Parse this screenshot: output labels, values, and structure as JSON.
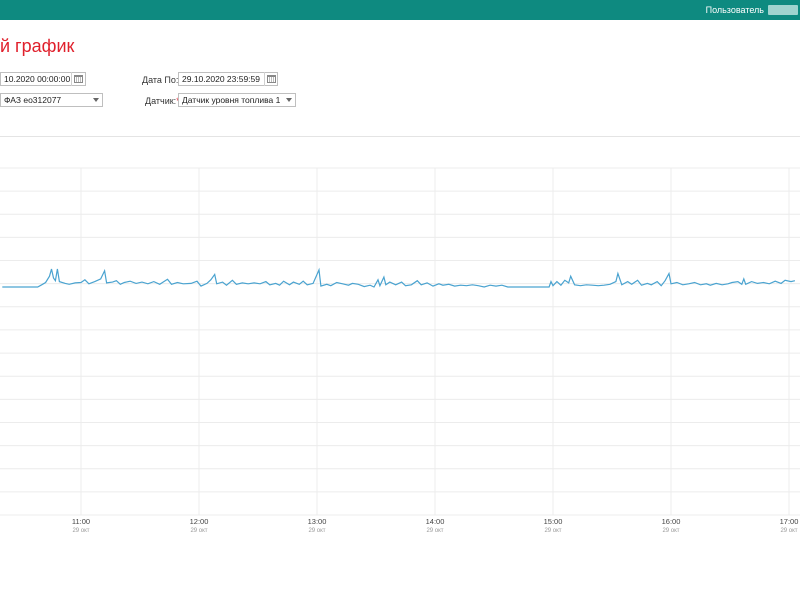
{
  "header": {
    "user_label": "Пользователь"
  },
  "page": {
    "title": "й график"
  },
  "filters": {
    "date_from_value": "10.2020 00:00:00",
    "date_to_label": "Дата По:",
    "required_mark": "*",
    "date_to_value": "29.10.2020 23:59:59",
    "vehicle_value": "ФАЗ ео312077",
    "sensor_label": "Датчик:",
    "sensor_value": "Датчик уровня топлива 1"
  },
  "colors": {
    "header_bg": "#0e8a80",
    "title": "#e0202c",
    "series_line": "#4aa3d0"
  },
  "chart_data": {
    "type": "line",
    "title": "",
    "xlabel": "",
    "ylabel": "",
    "grid": true,
    "x_ticks": [
      {
        "time": "11:00",
        "date": "29 окт"
      },
      {
        "time": "12:00",
        "date": "29 окт"
      },
      {
        "time": "13:00",
        "date": "29 окт"
      },
      {
        "time": "14:00",
        "date": "29 окт"
      },
      {
        "time": "15:00",
        "date": "29 окт"
      },
      {
        "time": "16:00",
        "date": "29 окт"
      },
      {
        "time": "17:00",
        "date": "29 окт"
      }
    ],
    "xlim": [
      "10:20",
      "17:03"
    ],
    "series": [
      {
        "points": [
          [
            "10:20",
            0.0
          ],
          [
            "10:38",
            0.0
          ],
          [
            "10:40",
            0.5
          ],
          [
            "10:42",
            1.0
          ],
          [
            "10:44",
            2.4
          ],
          [
            "10:45",
            4.0
          ],
          [
            "10:46",
            2.0
          ],
          [
            "10:47",
            1.4
          ],
          [
            "10:48",
            4.0
          ],
          [
            "10:49",
            1.2
          ],
          [
            "10:52",
            0.8
          ],
          [
            "10:54",
            0.6
          ],
          [
            "10:57",
            0.9
          ],
          [
            "11:00",
            1.0
          ],
          [
            "11:02",
            1.6
          ],
          [
            "11:04",
            0.7
          ],
          [
            "11:07",
            1.2
          ],
          [
            "11:10",
            1.8
          ],
          [
            "11:12",
            3.6
          ],
          [
            "11:13",
            0.9
          ],
          [
            "11:16",
            1.1
          ],
          [
            "11:18",
            1.4
          ],
          [
            "11:20",
            0.6
          ],
          [
            "11:22",
            1.0
          ],
          [
            "11:25",
            1.3
          ],
          [
            "11:28",
            0.8
          ],
          [
            "11:31",
            1.1
          ],
          [
            "11:34",
            0.7
          ],
          [
            "11:37",
            1.2
          ],
          [
            "11:40",
            0.6
          ],
          [
            "11:44",
            1.7
          ],
          [
            "11:46",
            0.6
          ],
          [
            "11:49",
            1.0
          ],
          [
            "11:52",
            0.7
          ],
          [
            "11:56",
            0.8
          ],
          [
            "11:59",
            1.3
          ],
          [
            "12:01",
            0.2
          ],
          [
            "12:04",
            0.8
          ],
          [
            "12:06",
            1.6
          ],
          [
            "12:08",
            2.8
          ],
          [
            "12:09",
            0.7
          ],
          [
            "12:12",
            1.1
          ],
          [
            "12:14",
            0.4
          ],
          [
            "12:17",
            1.5
          ],
          [
            "12:19",
            0.6
          ],
          [
            "12:22",
            0.9
          ],
          [
            "12:25",
            0.7
          ],
          [
            "12:28",
            0.9
          ],
          [
            "12:31",
            0.7
          ],
          [
            "12:34",
            1.2
          ],
          [
            "12:36",
            0.5
          ],
          [
            "12:39",
            0.8
          ],
          [
            "12:41",
            0.4
          ],
          [
            "12:43",
            1.3
          ],
          [
            "12:46",
            0.5
          ],
          [
            "12:48",
            1.1
          ],
          [
            "12:51",
            0.6
          ],
          [
            "12:53",
            1.3
          ],
          [
            "12:55",
            0.5
          ],
          [
            "12:58",
            0.8
          ],
          [
            "13:01",
            3.8
          ],
          [
            "13:02",
            0.2
          ],
          [
            "13:05",
            0.6
          ],
          [
            "13:07",
            0.3
          ],
          [
            "13:10",
            1.0
          ],
          [
            "13:13",
            0.7
          ],
          [
            "13:16",
            0.4
          ],
          [
            "13:18",
            0.8
          ],
          [
            "13:21",
            0.6
          ],
          [
            "13:24",
            0.1
          ],
          [
            "13:27",
            0.4
          ],
          [
            "13:29",
            0.0
          ],
          [
            "13:31",
            1.6
          ],
          [
            "13:32",
            0.3
          ],
          [
            "13:34",
            2.2
          ],
          [
            "13:35",
            0.5
          ],
          [
            "13:37",
            1.1
          ],
          [
            "13:40",
            0.5
          ],
          [
            "13:43",
            1.1
          ],
          [
            "13:45",
            0.3
          ],
          [
            "13:48",
            0.5
          ],
          [
            "13:51",
            1.4
          ],
          [
            "13:53",
            0.5
          ],
          [
            "13:56",
            0.9
          ],
          [
            "13:59",
            0.2
          ],
          [
            "14:02",
            0.7
          ],
          [
            "14:04",
            0.4
          ],
          [
            "14:07",
            0.6
          ],
          [
            "14:10",
            0.2
          ],
          [
            "14:13",
            0.4
          ],
          [
            "14:16",
            0.3
          ],
          [
            "14:19",
            0.5
          ],
          [
            "14:22",
            0.3
          ],
          [
            "14:25",
            0.0
          ],
          [
            "14:28",
            0.4
          ],
          [
            "14:31",
            0.2
          ],
          [
            "14:34",
            0.4
          ],
          [
            "14:37",
            0.0
          ],
          [
            "14:40",
            0.0
          ],
          [
            "14:46",
            0.0
          ],
          [
            "14:52",
            0.0
          ],
          [
            "14:58",
            0.0
          ],
          [
            "14:59",
            1.2
          ],
          [
            "15:00",
            0.3
          ],
          [
            "15:02",
            1.2
          ],
          [
            "15:04",
            0.4
          ],
          [
            "15:06",
            1.5
          ],
          [
            "15:08",
            0.9
          ],
          [
            "15:09",
            2.4
          ],
          [
            "15:11",
            0.5
          ],
          [
            "15:14",
            0.3
          ],
          [
            "15:17",
            0.5
          ],
          [
            "15:20",
            0.4
          ],
          [
            "15:23",
            0.3
          ],
          [
            "15:26",
            0.4
          ],
          [
            "15:29",
            0.6
          ],
          [
            "15:32",
            1.2
          ],
          [
            "15:33",
            3.0
          ],
          [
            "15:35",
            0.5
          ],
          [
            "15:38",
            1.2
          ],
          [
            "15:40",
            0.6
          ],
          [
            "15:43",
            1.5
          ],
          [
            "15:45",
            0.4
          ],
          [
            "15:48",
            0.8
          ],
          [
            "15:50",
            0.5
          ],
          [
            "15:53",
            1.2
          ],
          [
            "15:55",
            0.3
          ],
          [
            "15:57",
            1.4
          ],
          [
            "15:59",
            3.0
          ],
          [
            "16:00",
            0.7
          ],
          [
            "16:03",
            1.0
          ],
          [
            "16:06",
            0.5
          ],
          [
            "16:09",
            0.7
          ],
          [
            "16:12",
            1.0
          ],
          [
            "16:15",
            0.5
          ],
          [
            "16:18",
            0.7
          ],
          [
            "16:20",
            0.4
          ],
          [
            "16:23",
            0.8
          ],
          [
            "16:26",
            0.5
          ],
          [
            "16:29",
            0.7
          ],
          [
            "16:31",
            1.0
          ],
          [
            "16:34",
            1.2
          ],
          [
            "16:36",
            0.6
          ],
          [
            "16:37",
            1.8
          ],
          [
            "16:38",
            0.6
          ],
          [
            "16:41",
            1.2
          ],
          [
            "16:44",
            0.8
          ],
          [
            "16:47",
            1.0
          ],
          [
            "16:50",
            0.7
          ],
          [
            "16:53",
            1.3
          ],
          [
            "16:56",
            0.8
          ],
          [
            "16:58",
            1.5
          ],
          [
            "17:01",
            1.2
          ],
          [
            "17:03",
            1.4
          ]
        ]
      }
    ]
  }
}
